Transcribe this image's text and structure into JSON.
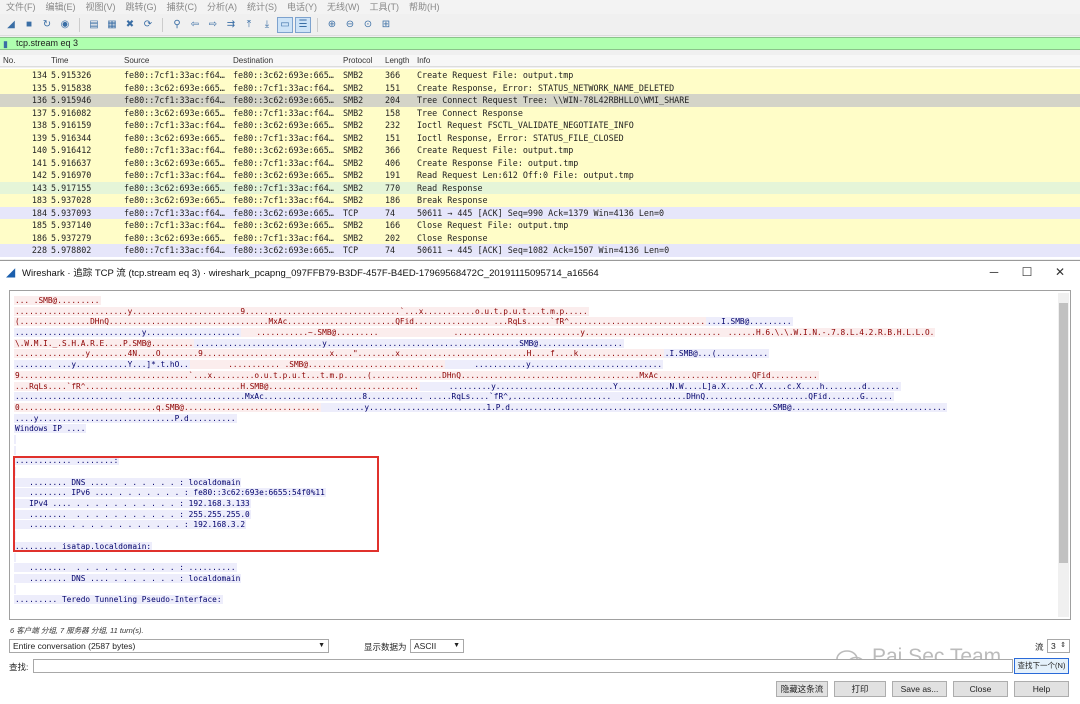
{
  "menu": [
    "文件(F)",
    "编辑(E)",
    "视图(V)",
    "跳转(G)",
    "捕获(C)",
    "分析(A)",
    "统计(S)",
    "电话(Y)",
    "无线(W)",
    "工具(T)",
    "帮助(H)"
  ],
  "filter": {
    "text": "tcp.stream eq 3"
  },
  "columns": {
    "no": "No.",
    "time": "Time",
    "source": "Source",
    "destination": "Destination",
    "protocol": "Protocol",
    "length": "Length",
    "info": "Info"
  },
  "packets": [
    {
      "no": "134",
      "time": "5.915326",
      "src": "fe80::7cf1:33ac:f64…",
      "dst": "fe80::3c62:693e:665…",
      "proto": "SMB2",
      "len": "366",
      "info": "Create Request File: output.tmp",
      "kind": "smb2"
    },
    {
      "no": "135",
      "time": "5.915838",
      "src": "fe80::3c62:693e:665…",
      "dst": "fe80::7cf1:33ac:f64…",
      "proto": "SMB2",
      "len": "151",
      "info": "Create Response, Error: STATUS_NETWORK_NAME_DELETED",
      "kind": "smb2"
    },
    {
      "no": "136",
      "time": "5.915946",
      "src": "fe80::7cf1:33ac:f64…",
      "dst": "fe80::3c62:693e:665…",
      "proto": "SMB2",
      "len": "204",
      "info": "Tree Connect Request Tree: \\\\WIN-78L42RBHLLO\\WMI_SHARE",
      "kind": "sel"
    },
    {
      "no": "137",
      "time": "5.916082",
      "src": "fe80::3c62:693e:665…",
      "dst": "fe80::7cf1:33ac:f64…",
      "proto": "SMB2",
      "len": "158",
      "info": "Tree Connect Response",
      "kind": "smb2"
    },
    {
      "no": "138",
      "time": "5.916159",
      "src": "fe80::7cf1:33ac:f64…",
      "dst": "fe80::3c62:693e:665…",
      "proto": "SMB2",
      "len": "232",
      "info": "Ioctl Request FSCTL_VALIDATE_NEGOTIATE_INFO",
      "kind": "smb2"
    },
    {
      "no": "139",
      "time": "5.916344",
      "src": "fe80::3c62:693e:665…",
      "dst": "fe80::7cf1:33ac:f64…",
      "proto": "SMB2",
      "len": "151",
      "info": "Ioctl Response, Error: STATUS_FILE_CLOSED",
      "kind": "smb2"
    },
    {
      "no": "140",
      "time": "5.916412",
      "src": "fe80::7cf1:33ac:f64…",
      "dst": "fe80::3c62:693e:665…",
      "proto": "SMB2",
      "len": "366",
      "info": "Create Request File: output.tmp",
      "kind": "smb2"
    },
    {
      "no": "141",
      "time": "5.916637",
      "src": "fe80::3c62:693e:665…",
      "dst": "fe80::7cf1:33ac:f64…",
      "proto": "SMB2",
      "len": "406",
      "info": "Create Response File: output.tmp",
      "kind": "smb2"
    },
    {
      "no": "142",
      "time": "5.916970",
      "src": "fe80::7cf1:33ac:f64…",
      "dst": "fe80::3c62:693e:665…",
      "proto": "SMB2",
      "len": "191",
      "info": "Read Request Len:612 Off:0 File: output.tmp",
      "kind": "smb2"
    },
    {
      "no": "143",
      "time": "5.917155",
      "src": "fe80::3c62:693e:665…",
      "dst": "fe80::7cf1:33ac:f64…",
      "proto": "SMB2",
      "len": "770",
      "info": "Read Response",
      "kind": "green"
    },
    {
      "no": "183",
      "time": "5.937028",
      "src": "fe80::3c62:693e:665…",
      "dst": "fe80::7cf1:33ac:f64…",
      "proto": "SMB2",
      "len": "186",
      "info": "Break Response",
      "kind": "smb2"
    },
    {
      "no": "184",
      "time": "5.937093",
      "src": "fe80::7cf1:33ac:f64…",
      "dst": "fe80::3c62:693e:665…",
      "proto": "TCP",
      "len": "74",
      "info": "50611 → 445 [ACK] Seq=990 Ack=1379 Win=4136 Len=0",
      "kind": "tcp"
    },
    {
      "no": "185",
      "time": "5.937140",
      "src": "fe80::7cf1:33ac:f64…",
      "dst": "fe80::3c62:693e:665…",
      "proto": "SMB2",
      "len": "166",
      "info": "Close Request File: output.tmp",
      "kind": "smb2"
    },
    {
      "no": "186",
      "time": "5.937279",
      "src": "fe80::3c62:693e:665…",
      "dst": "fe80::7cf1:33ac:f64…",
      "proto": "SMB2",
      "len": "202",
      "info": "Close Response",
      "kind": "smb2"
    },
    {
      "no": "228",
      "time": "5.978802",
      "src": "fe80::7cf1:33ac:f64…",
      "dst": "fe80::3c62:693e:665…",
      "proto": "TCP",
      "len": "74",
      "info": "50611 → 445 [ACK] Seq=1082 Ack=1507 Win=4136 Len=0",
      "kind": "tcp"
    }
  ],
  "follow": {
    "title": "Wireshark · 追踪 TCP 流 (tcp.stream eq 3) · wireshark_pcapng_097FFB79-B3DF-457F-B4ED-17969568472C_20191115095714_a16564",
    "stream_lines": [
      {
        "parts": [
          {
            "t": "... .SMB@.........",
            "c": "cli"
          }
        ]
      },
      {
        "parts": [
          {
            "t": "........................y.......................9.................................`...x...........o.u.t.p.u.t...t.m.p.....",
            "c": "cli"
          }
        ]
      },
      {
        "parts": [
          {
            "t": "(...............DHnQ..................................MxAc.......................QFid................ ...RqLs.....`fR^.............................",
            "c": "cli"
          },
          {
            "t": "...I.SMB@.........",
            "c": "srv"
          }
        ]
      },
      {
        "parts": [
          {
            "t": "...........................y....................",
            "c": "srv"
          },
          {
            "t": "   ...........~.SMB@.........                ...........................y.............................",
            "c": "cli"
          },
          {
            "t": " ......H.6.\\.\\.W.I.N.-.7.8.L.4.2.R.B.H.L.L.O.",
            "c": "cli"
          }
        ]
      },
      {
        "parts": [
          {
            "t": "\\.W.M.I._.S.H.A.R.E....P.SMB@.........",
            "c": "cli"
          },
          {
            "t": "...........................y.........................................SMB@..................",
            "c": "srv"
          }
        ]
      },
      {
        "parts": [
          {
            "t": "...............y........4N....O........9...........................x....\"........x...........................H....f....k..................",
            "c": "cli"
          },
          {
            "t": ".I.SMB@...(...........",
            "c": "srv"
          }
        ]
      },
      {
        "parts": [
          {
            "t": "........ ...y...........Y...]*.t.hO..",
            "c": "srv"
          },
          {
            "t": "        ........... .SMB@.............................",
            "c": "cli"
          },
          {
            "t": "      ...........y............................",
            "c": "srv"
          }
        ]
      },
      {
        "parts": [
          {
            "t": "9....................................`...x.........o.u.t.p.u.t...t.m.p.....(...............DHnQ......................................MxAc....................QFid..........",
            "c": "cli"
          }
        ]
      },
      {
        "parts": [
          {
            "t": "...RqLs....`fR^.................................H.SMB@................................",
            "c": "cli"
          },
          {
            "t": "      .........y.........................Y...........N.W....L]a.X.....c.X.....c.X....h........d.......",
            "c": "srv"
          }
        ]
      },
      {
        "parts": [
          {
            "t": "....................... .........................MxAc.....................8............ .....RqLs....`fR^,.....................  ..............DHnQ......................QFid.......G......",
            "c": "srv"
          }
        ]
      },
      {
        "parts": [
          {
            "t": "0.............................q.SMB@.............................",
            "c": "cli"
          },
          {
            "t": "   ......y.........................1.P.d........................................................SMB@.................................",
            "c": "srv"
          }
        ]
      },
      {
        "parts": [
          {
            "t": "....y.............................P.d..........",
            "c": "srv"
          }
        ]
      },
      {
        "parts": [
          {
            "t": "Windows IP ....",
            "c": "srv"
          }
        ]
      },
      {
        "parts": [
          {
            "t": "",
            "c": "srv"
          }
        ]
      },
      {
        "parts": [
          {
            "t": "",
            "c": "srv"
          }
        ]
      },
      {
        "parts": [
          {
            "t": "............ ........:",
            "c": "srv"
          }
        ]
      },
      {
        "parts": [
          {
            "t": "",
            "c": "srv"
          }
        ]
      },
      {
        "parts": [
          {
            "t": "   ........ DNS .... . . . . . . . : localdomain",
            "c": "srv"
          }
        ]
      },
      {
        "parts": [
          {
            "t": "   ........ IPv6 .... . . . . . . . : fe80::3c62:693e:6655:54f0%11",
            "c": "srv"
          }
        ]
      },
      {
        "parts": [
          {
            "t": "   IPv4 .... . . . . . . . . . . . : 192.168.3.133",
            "c": "srv"
          }
        ]
      },
      {
        "parts": [
          {
            "t": "   ........  . . . . . . . . . . . : 255.255.255.0",
            "c": "srv"
          }
        ]
      },
      {
        "parts": [
          {
            "t": "   ........ . . . . . . . . . . . . : 192.168.3.2",
            "c": "srv"
          }
        ]
      },
      {
        "parts": [
          {
            "t": "",
            "c": "srv"
          }
        ]
      },
      {
        "parts": [
          {
            "t": "......... isatap.localdomain:",
            "c": "srv"
          }
        ]
      },
      {
        "parts": [
          {
            "t": "",
            "c": "srv"
          }
        ]
      },
      {
        "parts": [
          {
            "t": "   ........  . . . . . . . . . . . : ..........",
            "c": "srv"
          }
        ]
      },
      {
        "parts": [
          {
            "t": "   ........ DNS .... . . . . . . . : localdomain",
            "c": "srv"
          }
        ]
      },
      {
        "parts": [
          {
            "t": "",
            "c": "srv"
          }
        ]
      },
      {
        "parts": [
          {
            "t": "......... Teredo Tunneling Pseudo-Interface:",
            "c": "srv"
          }
        ]
      }
    ],
    "status": "6 客户端 分组, 7 服务器 分组, 11 turn(s).",
    "conversation": "Entire conversation (2587 bytes)",
    "show_as_label": "显示数据为",
    "encoding": "ASCII",
    "stream_label": "流",
    "stream_no": "3",
    "find_label": "查找:",
    "find_next": "查找下一个(N)",
    "buttons": {
      "filter_out": "隐藏这条流",
      "print": "打印",
      "save_as": "Save as...",
      "close": "Close",
      "help": "Help"
    },
    "watermark": "Pai Sec Team"
  }
}
